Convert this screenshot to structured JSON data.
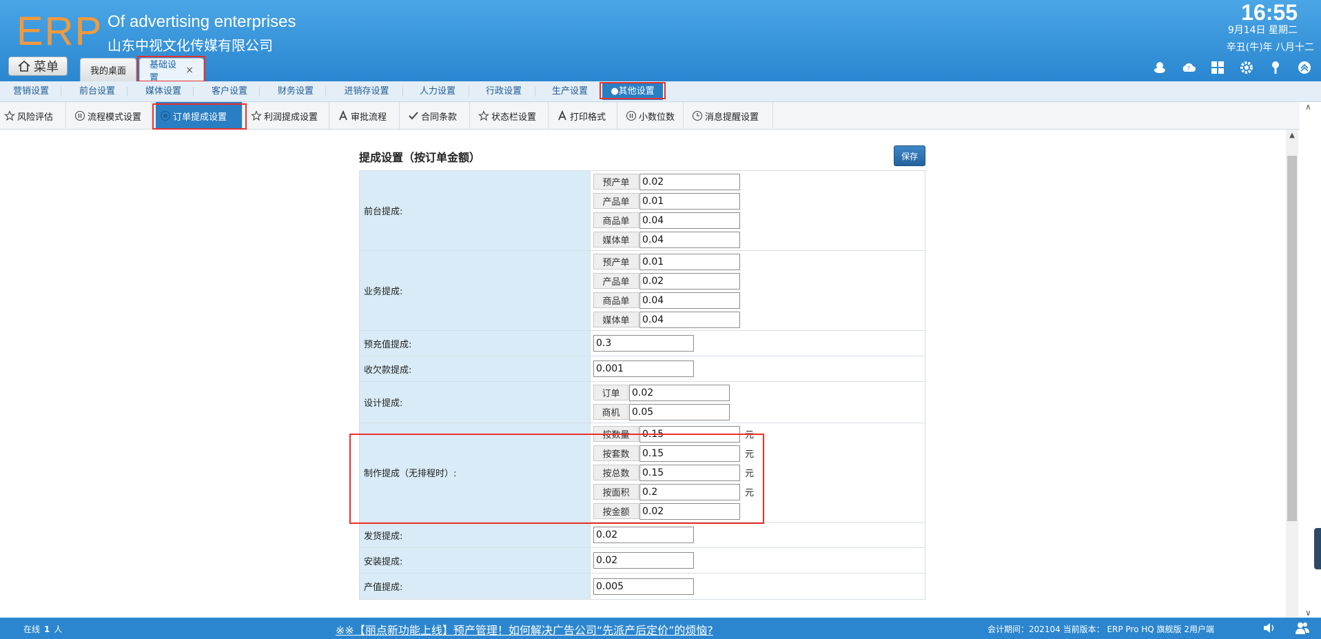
{
  "header": {
    "logo": "ERP",
    "app_title": "Of advertising enterprises",
    "company": "山东中视文化传媒有限公司",
    "time": "16:55",
    "date": "9月14日 星期二",
    "lunar": "辛丑(牛)年 八月十二",
    "menu_label": "菜单",
    "tabs": [
      {
        "label": "我的桌面"
      },
      {
        "label": "基础设置",
        "close": "×"
      }
    ]
  },
  "nav1": [
    {
      "label": "营销设置"
    },
    {
      "label": "前台设置"
    },
    {
      "label": "媒体设置"
    },
    {
      "label": "客户设置"
    },
    {
      "label": "财务设置"
    },
    {
      "label": "进销存设置"
    },
    {
      "label": "人力设置"
    },
    {
      "label": "行政设置"
    },
    {
      "label": "生产设置"
    },
    {
      "label": "●其他设置"
    }
  ],
  "nav2": [
    {
      "label": "风险评估",
      "icon": "star-icon"
    },
    {
      "label": "流程模式设置",
      "icon": "pause-circle-icon"
    },
    {
      "label": "订单提成设置",
      "icon": "dot-circle-icon"
    },
    {
      "label": "利润提成设置",
      "icon": "star-icon"
    },
    {
      "label": "审批流程",
      "icon": "letter-a-icon"
    },
    {
      "label": "合同条款",
      "icon": "check-icon"
    },
    {
      "label": "状态栏设置",
      "icon": "star-icon"
    },
    {
      "label": "打印格式",
      "icon": "letter-a-icon"
    },
    {
      "label": "小数位数",
      "icon": "pause-circle-icon"
    },
    {
      "label": "消息提醒设置",
      "icon": "clock-icon"
    }
  ],
  "form": {
    "title": "提成设置（按订单金额）",
    "save_label": "保存",
    "rows": {
      "front": {
        "label": "前台提成:",
        "items": [
          {
            "tag": "预产单",
            "value": "0.02"
          },
          {
            "tag": "产品单",
            "value": "0.01"
          },
          {
            "tag": "商品单",
            "value": "0.04"
          },
          {
            "tag": "媒体单",
            "value": "0.04"
          }
        ]
      },
      "business": {
        "label": "业务提成:",
        "items": [
          {
            "tag": "预产单",
            "value": "0.01"
          },
          {
            "tag": "产品单",
            "value": "0.02"
          },
          {
            "tag": "商品单",
            "value": "0.04"
          },
          {
            "tag": "媒体单",
            "value": "0.04"
          }
        ]
      },
      "recharge": {
        "label": "预充值提成:",
        "value": "0.3"
      },
      "collection": {
        "label": "收欠款提成:",
        "value": "0.001"
      },
      "design": {
        "label": "设计提成:",
        "items": [
          {
            "tag": "订单",
            "value": "0.02"
          },
          {
            "tag": "商机",
            "value": "0.05"
          }
        ]
      },
      "production": {
        "label": "制作提成（无排程时）:",
        "items": [
          {
            "tag": "按数量",
            "value": "0.15",
            "unit": "元"
          },
          {
            "tag": "按套数",
            "value": "0.15",
            "unit": "元"
          },
          {
            "tag": "按总数",
            "value": "0.15",
            "unit": "元"
          },
          {
            "tag": "按面积",
            "value": "0.2",
            "unit": "元"
          },
          {
            "tag": "按金额",
            "value": "0.02",
            "unit": ""
          }
        ]
      },
      "shipping": {
        "label": "发货提成:",
        "value": "0.02"
      },
      "install": {
        "label": "安装提成:",
        "value": "0.02"
      },
      "output": {
        "label": "产值提成:",
        "value": "0.005"
      }
    }
  },
  "footer": {
    "online_prefix": "在线",
    "online_count": "1",
    "online_suffix": "人",
    "notice": "※※【丽点新功能上线】预产管理！如何解决广告公司“先派产后定价”的烦恼?",
    "period": "会计期间：202104 当前版本： ERP Pro HQ 旗舰版 2用户端"
  }
}
